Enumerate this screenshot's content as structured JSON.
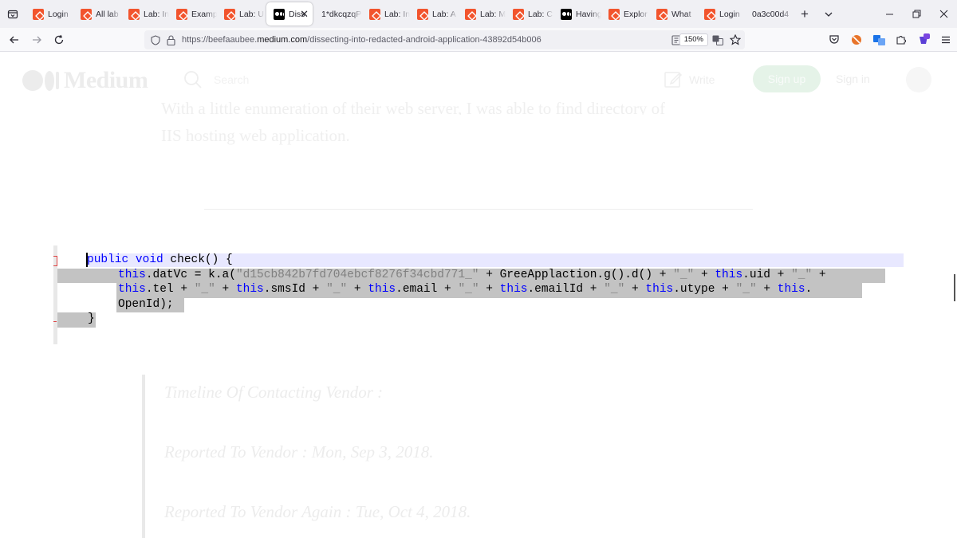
{
  "browser": {
    "tabs": [
      {
        "label": "Login",
        "favicon": "lab-icon"
      },
      {
        "label": "All lab",
        "favicon": "lab-icon"
      },
      {
        "label": "Lab: In",
        "favicon": "lab-icon"
      },
      {
        "label": "Examp",
        "favicon": "lab-icon"
      },
      {
        "label": "Lab: U",
        "favicon": "lab-icon"
      },
      {
        "label": "Diss",
        "favicon": "medium-icon",
        "active": true
      },
      {
        "label": "1*dkcqzqP",
        "favicon": "none"
      },
      {
        "label": "Lab: In",
        "favicon": "lab-icon"
      },
      {
        "label": "Lab: A",
        "favicon": "lab-icon"
      },
      {
        "label": "Lab: M",
        "favicon": "lab-icon"
      },
      {
        "label": "Lab: C",
        "favicon": "lab-icon"
      },
      {
        "label": "Having",
        "favicon": "medium-icon"
      },
      {
        "label": "Explor",
        "favicon": "lab-icon"
      },
      {
        "label": "What",
        "favicon": "lab-icon"
      },
      {
        "label": "Login",
        "favicon": "lab-icon"
      },
      {
        "label": "0a3c00d4",
        "favicon": "none"
      }
    ],
    "url_prefix": "https://beefaaubee.",
    "url_domain": "medium.com",
    "url_path": "/dissecting-into-redacted-android-application-43892d54b006",
    "zoom": "150%"
  },
  "site": {
    "logo_text": "Medium",
    "search_placeholder": "Search",
    "write_label": "Write",
    "signup_label": "Sign up",
    "signin_label": "Sign in"
  },
  "article": {
    "partial_line": "With a little enumeration of their web server, I was able to find directory of",
    "para_end": "IIS hosting web application.",
    "quote_lines": [
      "Timeline Of Contacting Vendor :",
      "Reported To Vendor : Mon, Sep 3, 2018.",
      "Reported To Vendor Again : Tue, Oct 4, 2018."
    ]
  },
  "code": {
    "line1": [
      {
        "t": "public void",
        "c": "kw"
      },
      {
        "t": " check() {",
        "c": "nm"
      }
    ],
    "line2": [
      {
        "t": "this",
        "c": "kw"
      },
      {
        "t": ".datVc = k.a(",
        "c": "nm"
      },
      {
        "t": "\"d15cb842b7fd704ebcf8276f34cbd771_\"",
        "c": "str"
      },
      {
        "t": " + GreeApplaction.g().d() + ",
        "c": "nm"
      },
      {
        "t": "\"_\"",
        "c": "str"
      },
      {
        "t": " + ",
        "c": "nm"
      },
      {
        "t": "this",
        "c": "kw"
      },
      {
        "t": ".uid + ",
        "c": "nm"
      },
      {
        "t": "\"_\"",
        "c": "str"
      },
      {
        "t": " +",
        "c": "nm"
      }
    ],
    "line3": [
      {
        "t": "this",
        "c": "kw"
      },
      {
        "t": ".tel + ",
        "c": "nm"
      },
      {
        "t": "\"_\"",
        "c": "str"
      },
      {
        "t": " + ",
        "c": "nm"
      },
      {
        "t": "this",
        "c": "kw"
      },
      {
        "t": ".smsId + ",
        "c": "nm"
      },
      {
        "t": "\"_\"",
        "c": "str"
      },
      {
        "t": " + ",
        "c": "nm"
      },
      {
        "t": "this",
        "c": "kw"
      },
      {
        "t": ".email + ",
        "c": "nm"
      },
      {
        "t": "\"_\"",
        "c": "str"
      },
      {
        "t": " + ",
        "c": "nm"
      },
      {
        "t": "this",
        "c": "kw"
      },
      {
        "t": ".emailId + ",
        "c": "nm"
      },
      {
        "t": "\"_\"",
        "c": "str"
      },
      {
        "t": " + ",
        "c": "nm"
      },
      {
        "t": "this",
        "c": "kw"
      },
      {
        "t": ".utype + ",
        "c": "nm"
      },
      {
        "t": "\"_\"",
        "c": "str"
      },
      {
        "t": " + ",
        "c": "nm"
      },
      {
        "t": "this",
        "c": "kw"
      },
      {
        "t": ".",
        "c": "nm"
      }
    ],
    "line4": [
      {
        "t": "OpenId);",
        "c": "nm"
      }
    ],
    "line5": [
      {
        "t": "}",
        "c": "nm"
      }
    ]
  },
  "colors": {
    "keyword": "#0000ff",
    "string": "#808080",
    "selection": "#c3c3c3",
    "caret_line": "#e8e8ff",
    "lab_favicon": "#f2542d"
  }
}
